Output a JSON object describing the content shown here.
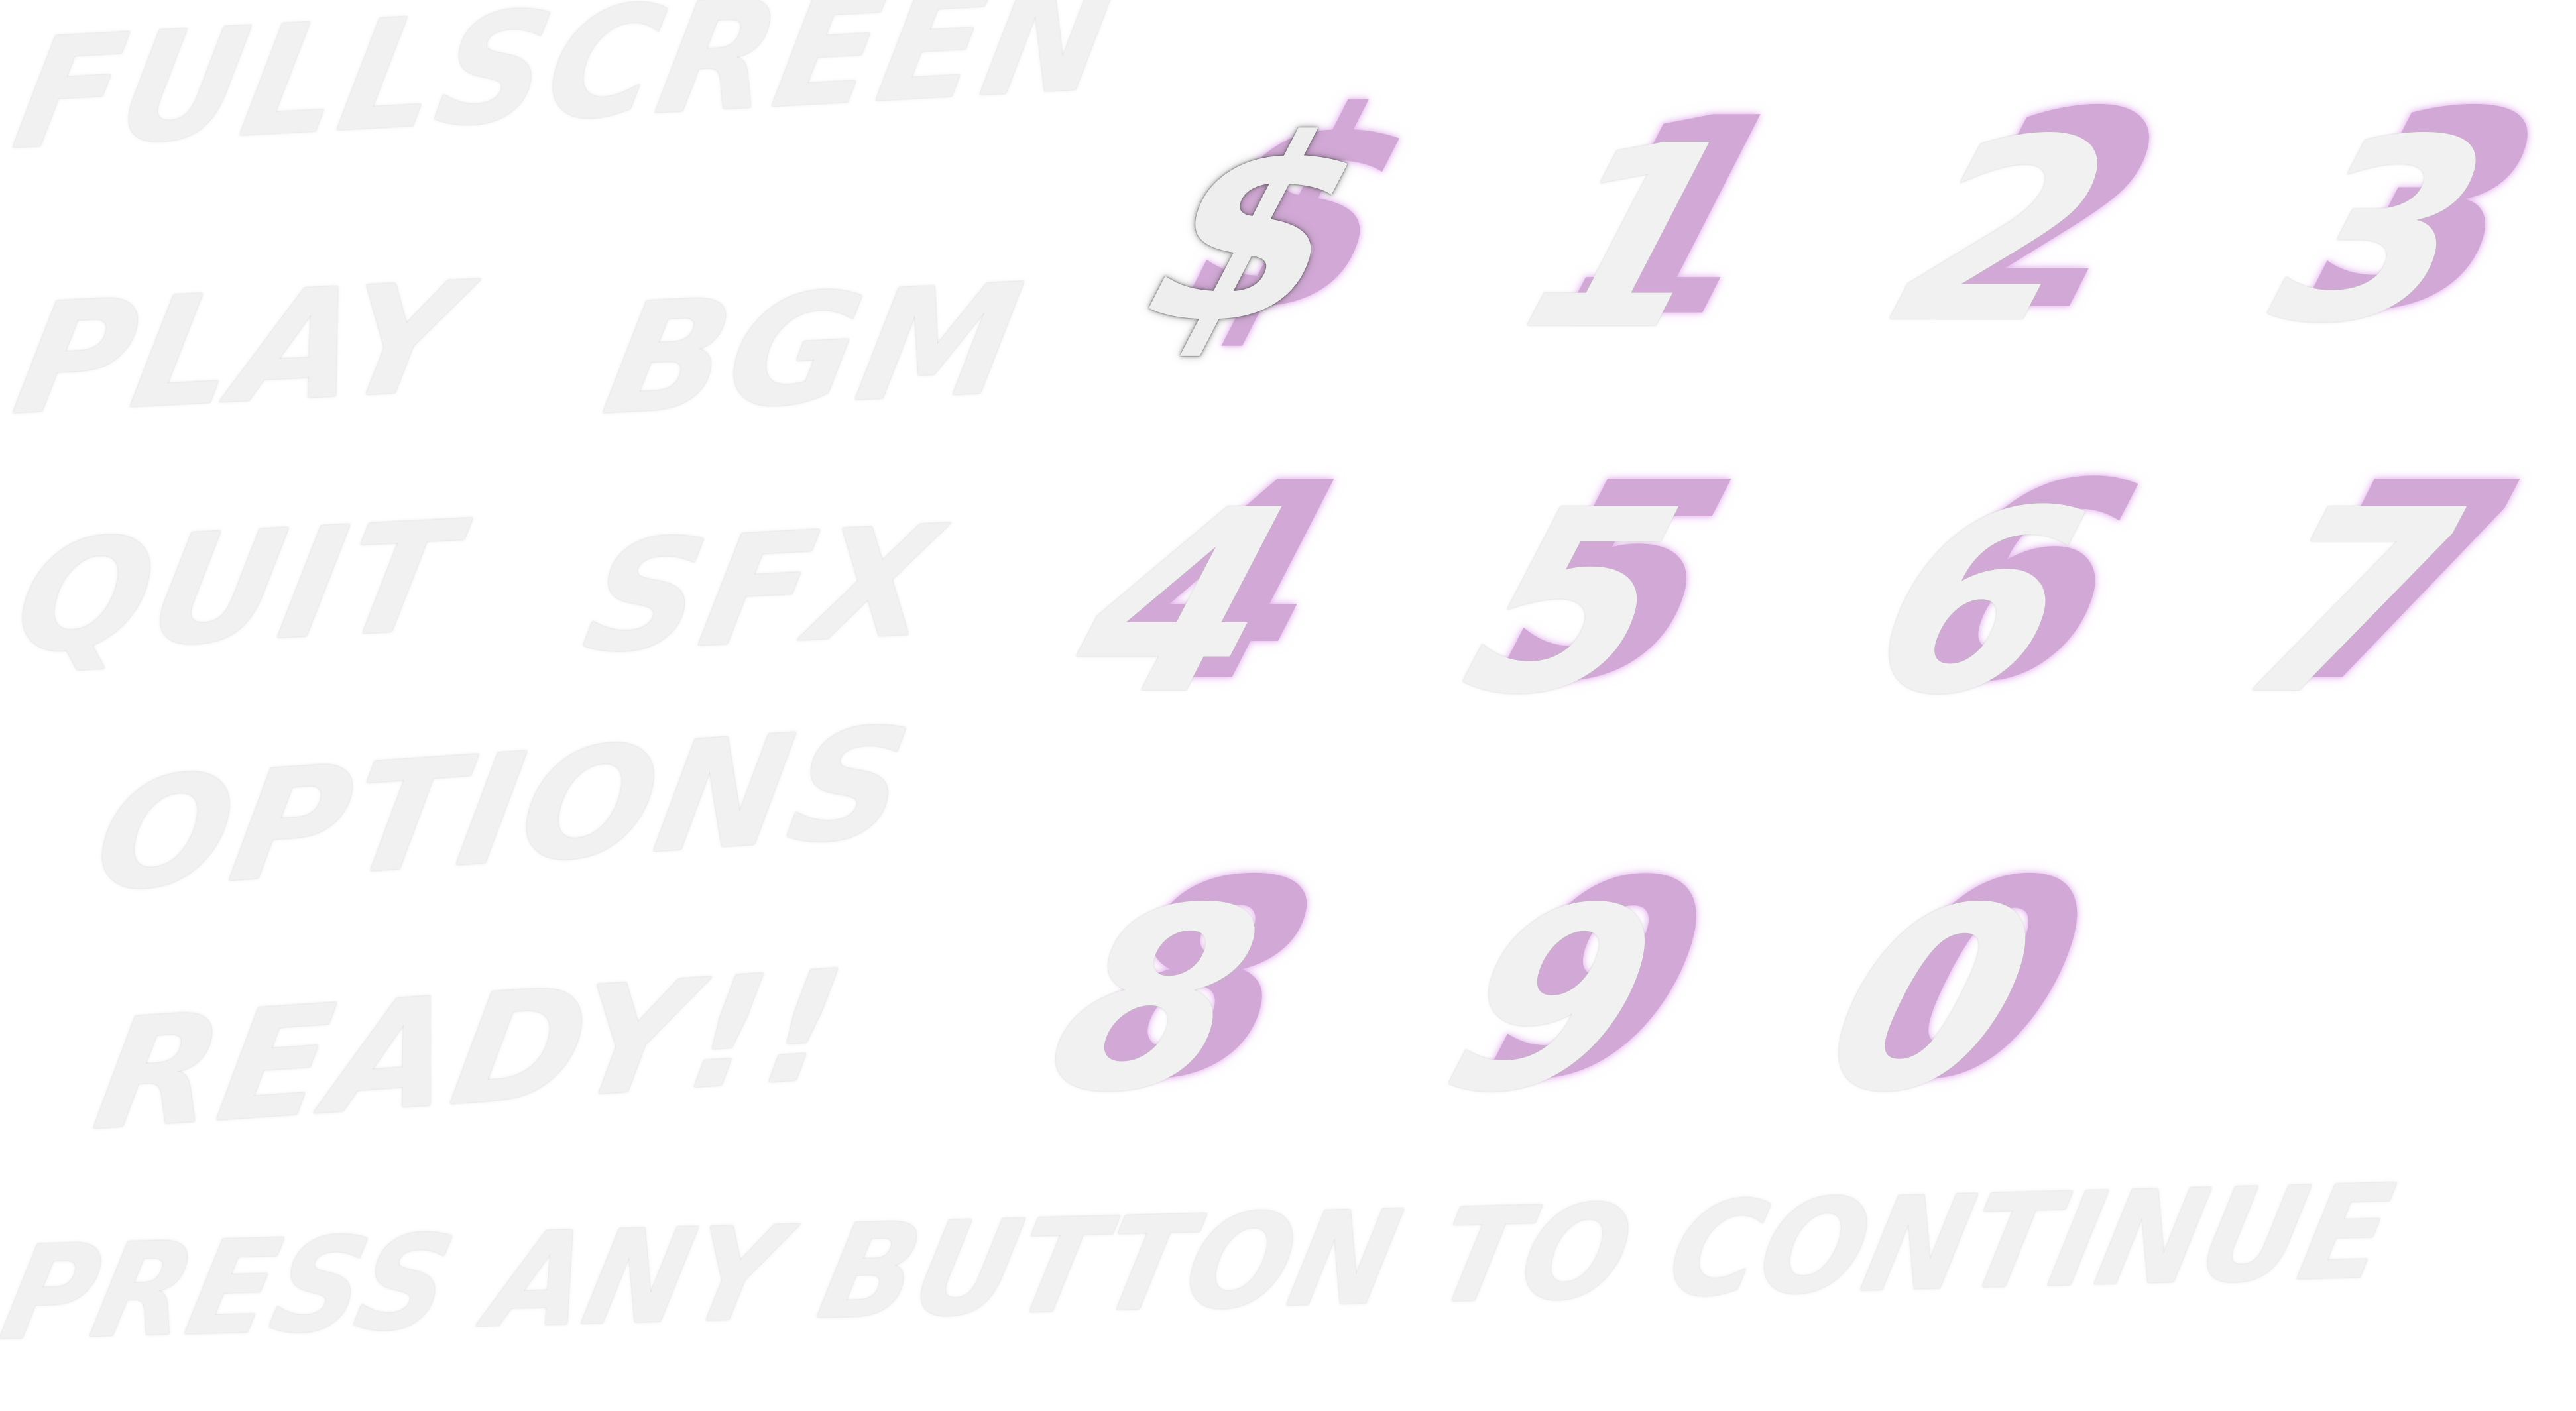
{
  "menu": {
    "fullscreen": "FULLSCREEN",
    "play": "PLAY",
    "bgm": "BGM",
    "quit": "QUIT",
    "sfx": "SFX",
    "options": "OPTIONS",
    "ready": "READY!!",
    "press_any_button": "PRESS ANY BUTTON TO CONTINUE"
  },
  "glyphs": {
    "dollar": "$",
    "one": "1",
    "two": "2",
    "three": "3",
    "four": "4",
    "five": "5",
    "six": "6",
    "seven": "7",
    "eight": "8",
    "nine": "9",
    "zero": "0"
  },
  "colors": {
    "text_fill": "#f1f1f1",
    "shadow_purple": "#d2a9d6",
    "background": "#ffffff"
  }
}
